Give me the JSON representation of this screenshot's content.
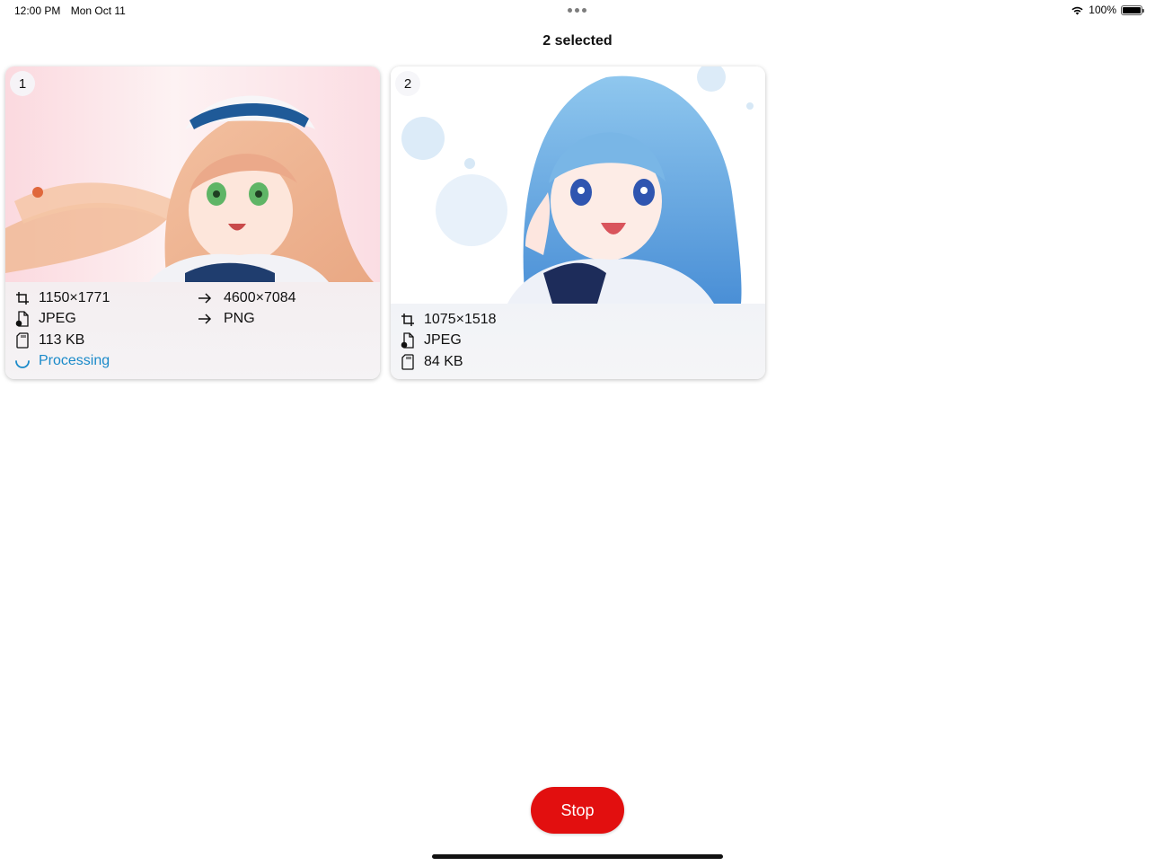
{
  "status_bar": {
    "time": "12:00 PM",
    "date": "Mon Oct 11",
    "battery": "100%"
  },
  "header": {
    "title": "2 selected"
  },
  "cards": [
    {
      "index": "1",
      "dimensions": "1150×1771",
      "target_dimensions": "4600×7084",
      "format": "JPEG",
      "target_format": "PNG",
      "size": "113 KB",
      "status": "Processing"
    },
    {
      "index": "2",
      "dimensions": "1075×1518",
      "format": "JPEG",
      "size": "84 KB"
    }
  ],
  "actions": {
    "stop_label": "Stop"
  },
  "colors": {
    "accent_red": "#e20f0f",
    "processing_blue": "#1a8ac9"
  },
  "icons": [
    "crop-icon",
    "file-format-icon",
    "file-size-icon",
    "arrow-right-icon",
    "spinner-icon",
    "wifi-icon",
    "battery-icon"
  ]
}
